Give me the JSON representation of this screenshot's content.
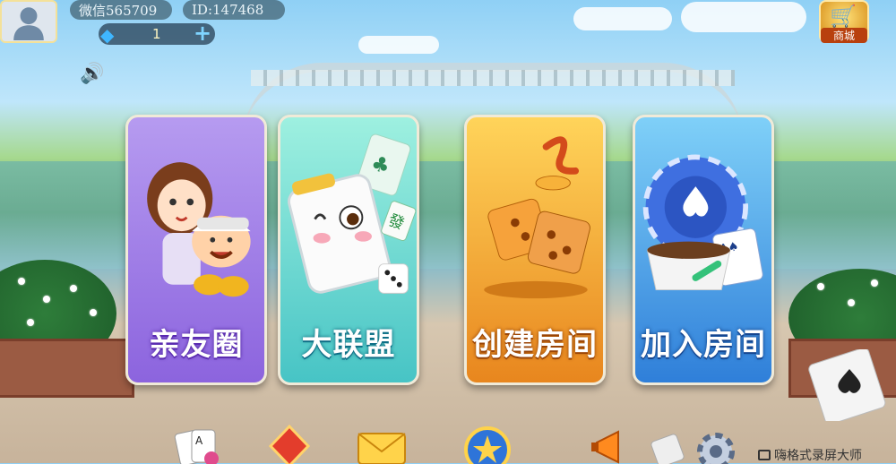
{
  "top_bar": {
    "nickname": "微信565709",
    "user_id": "ID:147468",
    "diamond_count": "1",
    "diamond_icon": "diamond-icon",
    "plus_icon": "plus-icon",
    "speaker_icon": "speaker-icon",
    "shop_label": "商城"
  },
  "menu_cards": [
    {
      "label": "亲友圈",
      "color": "#9a74e6"
    },
    {
      "label": "大联盟",
      "color": "#47c4c5"
    },
    {
      "label": "创建房间",
      "color": "#e8861e"
    },
    {
      "label": "加入房间",
      "color": "#2f7fd9"
    }
  ],
  "dock": {
    "icons": [
      "cards-icon",
      "red-diamond-icon",
      "envelope-icon",
      "star-badge-icon",
      "megaphone-icon",
      "gear-icon"
    ]
  },
  "watermark": "嗨格式录屏大师"
}
